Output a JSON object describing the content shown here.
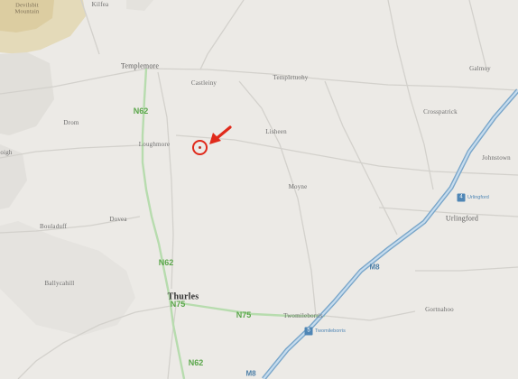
{
  "places": {
    "kilfea": "Kilfea",
    "devilsbit": "Devilsbit",
    "mountain": "Mountain",
    "templemore": "Templemore",
    "castleiny": "Castleiny",
    "templetuohy": "Templetuohy",
    "galmoy": "Galmoy",
    "crosspatrick": "Crosspatrick",
    "drom": "Drom",
    "loughmore": "Loughmore",
    "lisheen": "Lisheen",
    "johnstown": "Johnstown",
    "oigh": "oigh",
    "moyne": "Moyne",
    "urlingford": "Urlingford",
    "urlingford_junction": "Urlingford",
    "bouladuff": "Bouladuff",
    "dovea": "Dovea",
    "ballycahill": "Ballycahill",
    "thurles": "Thurles",
    "twomileborris": "Twomileborris",
    "twomileborris_junction": "Twomileborris",
    "gortnahoo": "Gortnahoo"
  },
  "roads": {
    "n62_north": "N62",
    "n62_mid": "N62",
    "n62_south": "N62",
    "n75_west": "N75",
    "n75_east": "N75",
    "m8_north": "M8",
    "m8_south": "M8"
  },
  "junctions": {
    "urlingford_no": "4",
    "twomileborris_no": "5"
  },
  "colors": {
    "background": "#eceae6",
    "n_road": "#5aa64a",
    "motorway": "#4f86b5",
    "marker": "#e02a1b"
  },
  "marker": {
    "icon": "location-marker-icon",
    "arrow": "pointer-arrow-icon"
  }
}
